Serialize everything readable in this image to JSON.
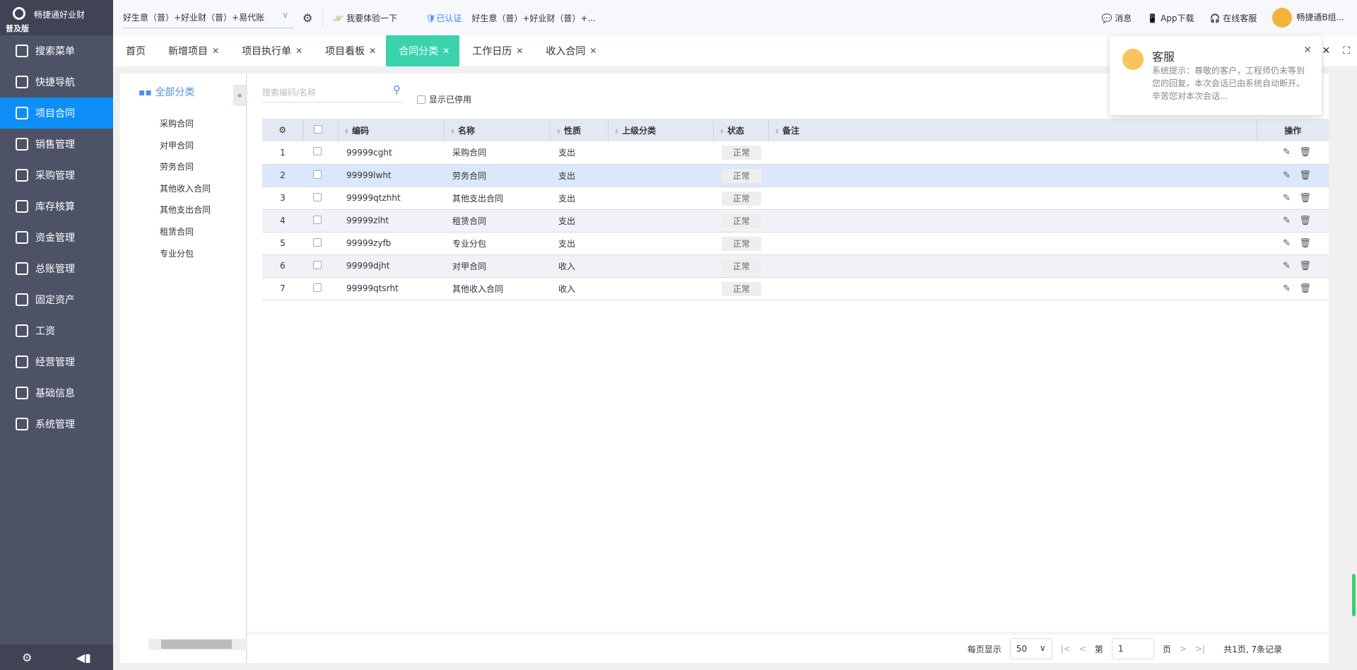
{
  "sidebar": {
    "brand": "畅捷通好业财",
    "edition": "普及版",
    "items": [
      {
        "label": "搜索菜单",
        "icon": "search-menu-icon"
      },
      {
        "label": "快捷导航",
        "icon": "home-icon"
      },
      {
        "label": "项目合同",
        "icon": "contract-icon",
        "active": true
      },
      {
        "label": "销售管理",
        "icon": "sales-icon"
      },
      {
        "label": "采购管理",
        "icon": "bag-icon"
      },
      {
        "label": "库存核算",
        "icon": "warehouse-icon"
      },
      {
        "label": "资金管理",
        "icon": "money-bag-icon"
      },
      {
        "label": "总账管理",
        "icon": "ledger-icon"
      },
      {
        "label": "固定资产",
        "icon": "building-icon"
      },
      {
        "label": "工资",
        "icon": "salary-icon"
      },
      {
        "label": "经营管理",
        "icon": "clipboard-icon"
      },
      {
        "label": "基础信息",
        "icon": "info-icon"
      },
      {
        "label": "系统管理",
        "icon": "system-icon"
      }
    ]
  },
  "topbar": {
    "workspace": "好生意（普）+好业财（普）+易代账",
    "experience": "我要体验一下",
    "certified": "已认证",
    "company": "好生意（普）+好业财（普）+...",
    "messages": "消息",
    "app_download": "App下载",
    "online_service": "在线客服",
    "user": "畅捷通B组..."
  },
  "tabs": [
    {
      "label": "首页",
      "closable": false
    },
    {
      "label": "新增项目",
      "closable": true
    },
    {
      "label": "项目执行单",
      "closable": true
    },
    {
      "label": "项目看板",
      "closable": true
    },
    {
      "label": "合同分类",
      "closable": true,
      "active": true
    },
    {
      "label": "工作日历",
      "closable": true
    },
    {
      "label": "收入合同",
      "closable": true
    }
  ],
  "tree": {
    "root": "全部分类",
    "nodes": [
      "采购合同",
      "对甲合同",
      "劳务合同",
      "其他收入合同",
      "其他支出合同",
      "租赁合同",
      "专业分包"
    ]
  },
  "filter": {
    "search_placeholder": "搜索编码/名称",
    "show_disabled": "显示已停用"
  },
  "table": {
    "columns": [
      "编码",
      "名称",
      "性质",
      "上级分类",
      "状态",
      "备注",
      "操作"
    ],
    "rows": [
      {
        "no": "1",
        "code": "99999cght",
        "name": "采购合同",
        "type": "支出",
        "parent": "",
        "status": "正常",
        "note": ""
      },
      {
        "no": "2",
        "code": "99999lwht",
        "name": "劳务合同",
        "type": "支出",
        "parent": "",
        "status": "正常",
        "note": ""
      },
      {
        "no": "3",
        "code": "99999qtzhht",
        "name": "其他支出合同",
        "type": "支出",
        "parent": "",
        "status": "正常",
        "note": ""
      },
      {
        "no": "4",
        "code": "99999zlht",
        "name": "租赁合同",
        "type": "支出",
        "parent": "",
        "status": "正常",
        "note": ""
      },
      {
        "no": "5",
        "code": "99999zyfb",
        "name": "专业分包",
        "type": "支出",
        "parent": "",
        "status": "正常",
        "note": ""
      },
      {
        "no": "6",
        "code": "99999djht",
        "name": "对甲合同",
        "type": "收入",
        "parent": "",
        "status": "正常",
        "note": ""
      },
      {
        "no": "7",
        "code": "99999qtsrht",
        "name": "其他收入合同",
        "type": "收入",
        "parent": "",
        "status": "正常",
        "note": ""
      }
    ]
  },
  "pager": {
    "per_page_label": "每页显示",
    "per_page": "50",
    "page_prefix": "第",
    "page": "1",
    "page_suffix": "页",
    "summary": "共1页, 7条记录"
  },
  "popup": {
    "title": "客服",
    "message": "系统提示：尊敬的客户，工程师仍未等到您的回复，本次会话已由系统自动断开。辛苦您对本次会话..."
  }
}
